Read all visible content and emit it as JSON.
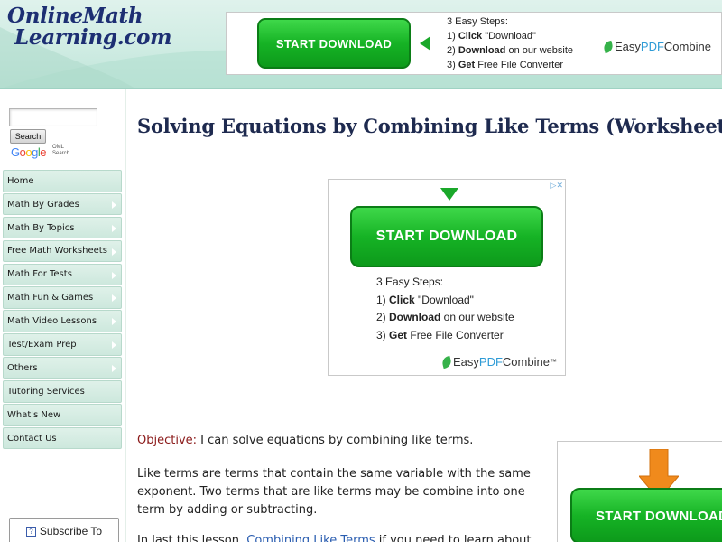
{
  "header": {
    "logo_line1": "OnlineMath",
    "logo_line2": "Learning.com",
    "ad": {
      "button_label": "START DOWNLOAD",
      "steps_title": "3 Easy Steps:",
      "step1_num": "1)",
      "step1_bold": "Click",
      "step1_rest": " \"Download\"",
      "step2_num": "2)",
      "step2_bold": "Download",
      "step2_rest": " on our website",
      "step3_num": "3)",
      "step3_bold": "Get",
      "step3_rest": " Free File Converter",
      "brand_a": "Easy",
      "brand_b": "PDF",
      "brand_c": "Combine"
    }
  },
  "sidebar": {
    "search_placeholder": "",
    "search_button": "Search",
    "google": [
      "G",
      "o",
      "o",
      "g",
      "l",
      "e"
    ],
    "oml_line1": "OML",
    "oml_line2": "Search",
    "nav": [
      {
        "label": "Home",
        "arrow": false
      },
      {
        "label": "Math By Grades",
        "arrow": true
      },
      {
        "label": "Math By Topics",
        "arrow": true
      },
      {
        "label": "Free Math Worksheets",
        "arrow": true
      },
      {
        "label": "Math For Tests",
        "arrow": true
      },
      {
        "label": "Math Fun & Games",
        "arrow": true
      },
      {
        "label": "Math Video Lessons",
        "arrow": true
      },
      {
        "label": "Test/Exam Prep",
        "arrow": true
      },
      {
        "label": "Others",
        "arrow": true
      },
      {
        "label": "Tutoring Services",
        "arrow": false
      },
      {
        "label": "What's New",
        "arrow": false
      },
      {
        "label": "Contact Us",
        "arrow": false
      }
    ],
    "subscribe_label": "Subscribe To",
    "subscribe_icon": "?"
  },
  "main": {
    "title": "Solving Equations by Combining Like Terms (Worksheet)",
    "ad": {
      "choices": "▷✕",
      "button_label": "START DOWNLOAD",
      "steps_title": "3 Easy Steps:",
      "step1_num": "1)",
      "step1_bold": "Click",
      "step1_rest": " \"Download\"",
      "step2_num": "2)",
      "step2_bold": "Download",
      "step2_rest": " on our website",
      "step3_num": "3)",
      "step3_bold": "Get",
      "step3_rest": " Free File Converter",
      "brand_a": "Easy",
      "brand_b": "PDF",
      "brand_c": "Combine",
      "brand_tm": "™"
    },
    "objective_label": "Objective:",
    "objective_text": " I can solve equations by combining like terms.",
    "paragraph2": "Like terms are terms that contain the same variable with the same exponent. Two terms that are like terms may be combine into one term by adding or subtracting.",
    "paragraph3_start": "In last this lesson,",
    "paragraph3_link": "Combining Like Terms",
    "paragraph3_end": " if you need to learn about",
    "side_ad_button": "START DOWNLOAD"
  },
  "colors": {
    "brand_navy": "#1d2f73",
    "header_green": "#cfece3",
    "download_green": "#16b325",
    "objective_red": "#8b1a1a",
    "link_blue": "#2a5db0",
    "arrow_orange": "#f08a1c"
  }
}
